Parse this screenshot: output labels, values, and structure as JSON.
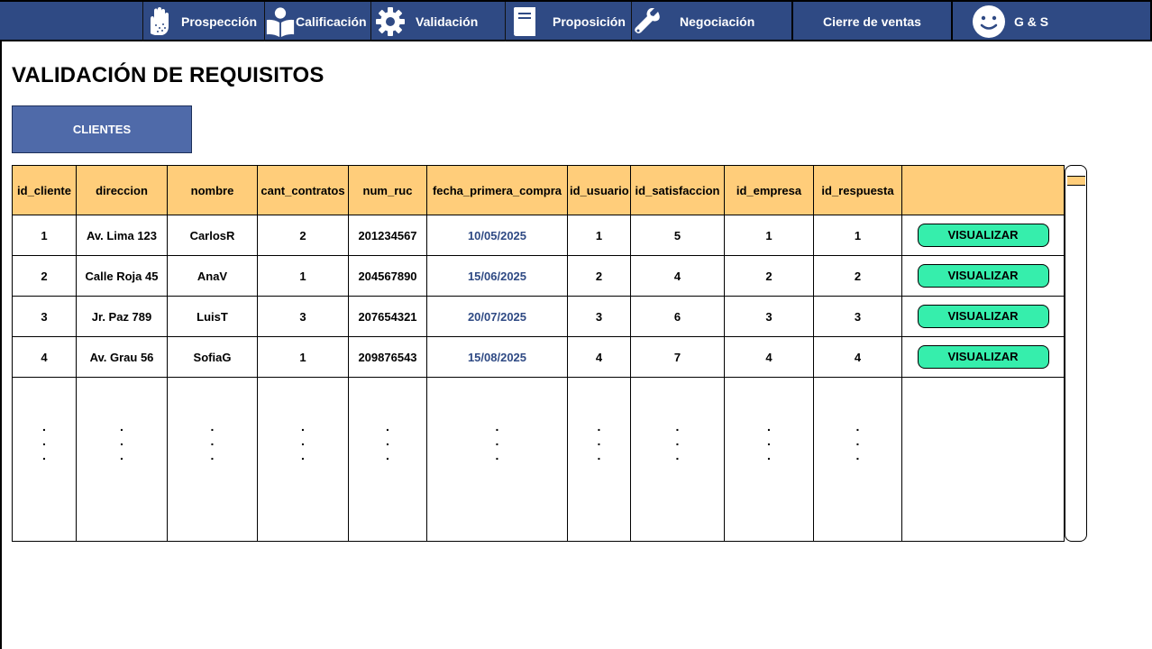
{
  "nav": {
    "items": [
      {
        "label": "Prospección",
        "icon": "hand-icon"
      },
      {
        "label": "Calificación",
        "icon": "person-reading-icon"
      },
      {
        "label": "Validación",
        "icon": "gear-icon"
      },
      {
        "label": "Proposición",
        "icon": "book-icon"
      },
      {
        "label": "Negociación",
        "icon": "wrench-icon"
      },
      {
        "label": "Cierre de ventas",
        "icon": ""
      },
      {
        "label": "G & S",
        "icon": "smiley-face-icon"
      }
    ]
  },
  "page": {
    "title": "VALIDACIÓN DE REQUISITOS",
    "tab_label": "CLIENTES"
  },
  "table": {
    "columns": [
      "id_cliente",
      "direccion",
      "nombre",
      "cant_contratos",
      "num_ruc",
      "fecha_primera_compra",
      "id_usuario",
      "id_satisfaccion",
      "id_empresa",
      "id_respuesta",
      ""
    ],
    "rows": [
      [
        "1",
        "Av. Lima 123",
        "CarlosR",
        "2",
        "201234567",
        "10/05/2025",
        "1",
        "5",
        "1",
        "1"
      ],
      [
        "2",
        "Calle Roja 45",
        "AnaV",
        "1",
        "204567890",
        "15/06/2025",
        "2",
        "4",
        "2",
        "2"
      ],
      [
        "3",
        "Jr. Paz 789",
        "LuisT",
        "3",
        "207654321",
        "20/07/2025",
        "3",
        "6",
        "3",
        "3"
      ],
      [
        "4",
        "Av. Grau 56",
        "SofiaG",
        "1",
        "209876543",
        "15/08/2025",
        "4",
        "7",
        "4",
        "4"
      ]
    ],
    "action_label": "VISUALIZAR",
    "ellipsis": ". . ."
  },
  "colors": {
    "nav_bg": "#2f4a84",
    "header_bg": "#ffcd7a",
    "tab_bg": "#4f6aa9",
    "button_bg": "#36eeac",
    "date_text": "#2f4a84"
  }
}
